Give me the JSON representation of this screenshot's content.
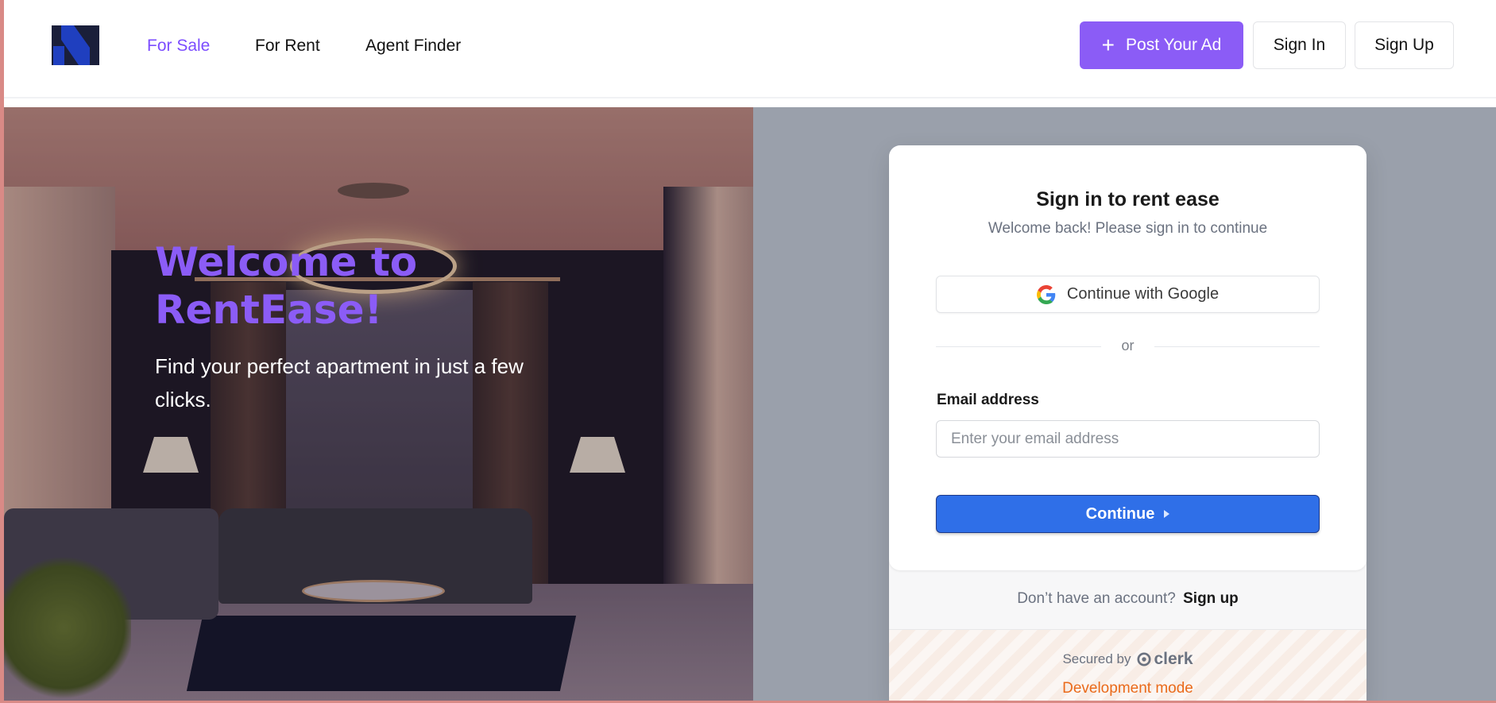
{
  "header": {
    "logo_alt": "RentEase logo",
    "nav": [
      {
        "label": "For Sale",
        "active": true
      },
      {
        "label": "For Rent",
        "active": false
      },
      {
        "label": "Agent Finder",
        "active": false
      }
    ],
    "post_ad_label": "Post Your Ad",
    "sign_in_label": "Sign In",
    "sign_up_label": "Sign Up"
  },
  "hero": {
    "title": "Welcome to RentEase!",
    "subtitle": "Find your perfect apartment in just a few clicks."
  },
  "signin": {
    "title": "Sign in to rent ease",
    "subtitle": "Welcome back! Please sign in to continue",
    "google_label": "Continue with Google",
    "divider_text": "or",
    "email_label": "Email address",
    "email_placeholder": "Enter your email address",
    "email_value": "",
    "continue_label": "Continue",
    "no_account_text": "Don’t have an account?",
    "sign_up_link": "Sign up",
    "secured_by": "Secured by",
    "clerk_brand": "clerk",
    "dev_mode": "Development mode"
  },
  "colors": {
    "accent": "#8b5cf6",
    "primary_button": "#2f6fe8",
    "dev_mode": "#ea6a1a",
    "right_panel_bg": "#9aa0ab"
  },
  "icons": {
    "post_ad": "plus-icon",
    "google": "google-g-icon",
    "continue": "triangle-right-icon",
    "clerk": "clerk-logo-icon"
  }
}
